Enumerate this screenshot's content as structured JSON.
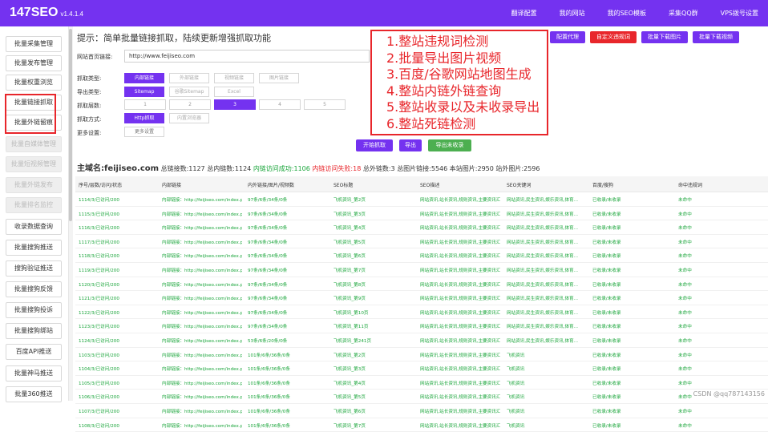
{
  "app": {
    "title": "147SEO",
    "version": "v1.4.1.4"
  },
  "topnav": [
    "翻译配置",
    "我的网站",
    "我的SEO模板",
    "采集QQ群",
    "VPS拨号设置"
  ],
  "sidebar": [
    {
      "label": "批量采集管理",
      "disabled": false
    },
    {
      "label": "批量发布管理",
      "disabled": false
    },
    {
      "label": "批量权重浏览",
      "disabled": false
    },
    {
      "label": "批量链接抓取",
      "disabled": false
    },
    {
      "label": "批量外链留痕",
      "disabled": false
    },
    {
      "label": "批量自媒体管理",
      "disabled": true
    },
    {
      "label": "批量短视频管理",
      "disabled": true
    },
    {
      "label": "批量外链发布",
      "disabled": true
    },
    {
      "label": "批量排名监控",
      "disabled": true
    },
    {
      "label": "收录数据查询",
      "disabled": false
    },
    {
      "label": "批量搜狗推送",
      "disabled": false
    },
    {
      "label": "搜狗验证推送",
      "disabled": false
    },
    {
      "label": "批量搜狗反馈",
      "disabled": false
    },
    {
      "label": "批量搜狗投诉",
      "disabled": false
    },
    {
      "label": "批量搜狗绑站",
      "disabled": false
    },
    {
      "label": "百度API推送",
      "disabled": false
    },
    {
      "label": "批量神马推送",
      "disabled": false
    },
    {
      "label": "批量360推送",
      "disabled": false
    }
  ],
  "hint": "提示：简单批量链接抓取，陆续更新增强抓取功能",
  "actions": [
    {
      "label": "配置代理",
      "style": "purple"
    },
    {
      "label": "自定义违规词",
      "style": "red"
    },
    {
      "label": "批量下载图片",
      "style": "purple"
    },
    {
      "label": "批量下载视频",
      "style": "purple"
    }
  ],
  "form": {
    "url_label": "网站首页链接:",
    "url_value": "http://www.feijiseo.com",
    "type_label": "抓取类型:",
    "type_options": [
      "内部链接",
      "外部链接",
      "视频链接",
      "图片链接"
    ],
    "export_label": "导出类型:",
    "export_options": [
      "Sitemap",
      "谷歌Sitemap",
      "Excel"
    ],
    "count_label": "抓取层数:",
    "count_options": [
      "1",
      "2",
      "3",
      "4",
      "5"
    ],
    "method_label": "抓取方式:",
    "method_options": [
      "Http抓取",
      "内置浏览器"
    ],
    "more_label": "更多设置:",
    "more_button": "更多设置"
  },
  "buttons": {
    "start": "开始抓取",
    "export": "导出",
    "export_unindexed": "导出未收录"
  },
  "features": [
    "1.整站违规词检测",
    "2.批量导出图片视频",
    "3.百度/谷歌网站地图生成",
    "4.整站内链外链查询",
    "5.整站收录以及未收录导出",
    "6.整站死链检测"
  ],
  "stats": {
    "domain_label": "主域名:feijiseo.com",
    "total_links": "总链接数:1127",
    "internal": "总内链数:1124",
    "success": "内链访问成功:1106",
    "fail": "内链访问失败:18",
    "external": "总外链数:3",
    "images": "总图片链接:5546",
    "site_images": "本站图片:2950",
    "offsite_images": "站外图片:2596"
  },
  "table": {
    "columns": [
      "序号/层数/访问/状态",
      "内部链接",
      "内外链接/图片/视频数",
      "SEO标题",
      "SEO描述",
      "SEO关键词",
      "百度/搜狗",
      "命中违规词"
    ],
    "rows": [
      [
        "1114/3/已访问/200",
        "内部链接：http://feijiseo.com/index.php",
        "97条/6条/34条/0条",
        "飞机资讯_第2页",
        "网站资讯,站长资讯,规则资讯,主要资讯汇...",
        "网站资讯,民生资讯,娱乐资讯,体育...",
        "已收录/未收录",
        "未命中"
      ],
      [
        "1115/3/已访问/200",
        "内部链接：http://feijiseo.com/index.php",
        "97条/6条/34条/0条",
        "飞机资讯_第3页",
        "网站资讯,站长资讯,规则资讯,主要资讯汇...",
        "网站资讯,民生资讯,娱乐资讯,体育...",
        "已收录/未收录",
        "未命中"
      ],
      [
        "1116/3/已访问/200",
        "内部链接：http://feijiseo.com/index.php",
        "97条/6条/34条/0条",
        "飞机资讯_第4页",
        "网站资讯,站长资讯,规则资讯,主要资讯汇...",
        "网站资讯,民生资讯,娱乐资讯,体育...",
        "已收录/未收录",
        "未命中"
      ],
      [
        "1117/3/已访问/200",
        "内部链接：http://feijiseo.com/index.php",
        "97条/6条/34条/0条",
        "飞机资讯_第5页",
        "网站资讯,站长资讯,规则资讯,主要资讯汇...",
        "网站资讯,民生资讯,娱乐资讯,体育...",
        "已收录/未收录",
        "未命中"
      ],
      [
        "1118/3/已访问/200",
        "内部链接：http://feijiseo.com/index.php",
        "97条/6条/34条/0条",
        "飞机资讯_第6页",
        "网站资讯,站长资讯,规则资讯,主要资讯汇...",
        "网站资讯,民生资讯,娱乐资讯,体育...",
        "已收录/未收录",
        "未命中"
      ],
      [
        "1119/3/已访问/200",
        "内部链接：http://feijiseo.com/index.php",
        "97条/6条/34条/0条",
        "飞机资讯_第7页",
        "网站资讯,站长资讯,规则资讯,主要资讯汇...",
        "网站资讯,民生资讯,娱乐资讯,体育...",
        "已收录/未收录",
        "未命中"
      ],
      [
        "1120/3/已访问/200",
        "内部链接：http://feijiseo.com/index.php",
        "97条/6条/34条/0条",
        "飞机资讯_第8页",
        "网站资讯,站长资讯,规则资讯,主要资讯汇...",
        "网站资讯,民生资讯,娱乐资讯,体育...",
        "已收录/未收录",
        "未命中"
      ],
      [
        "1121/3/已访问/200",
        "内部链接：http://feijiseo.com/index.php",
        "97条/6条/34条/0条",
        "飞机资讯_第9页",
        "网站资讯,站长资讯,规则资讯,主要资讯汇...",
        "网站资讯,民生资讯,娱乐资讯,体育...",
        "已收录/未收录",
        "未命中"
      ],
      [
        "1122/3/已访问/200",
        "内部链接：http://feijiseo.com/index.php",
        "97条/6条/34条/0条",
        "飞机资讯_第10页",
        "网站资讯,站长资讯,规则资讯,主要资讯汇...",
        "网站资讯,民生资讯,娱乐资讯,体育...",
        "已收录/未收录",
        "未命中"
      ],
      [
        "1123/3/已访问/200",
        "内部链接：http://feijiseo.com/index.php",
        "97条/6条/34条/0条",
        "飞机资讯_第11页",
        "网站资讯,站长资讯,规则资讯,主要资讯汇...",
        "网站资讯,民生资讯,娱乐资讯,体育...",
        "已收录/未收录",
        "未命中"
      ],
      [
        "1124/3/已访问/200",
        "内部链接：http://feijiseo.com/index.php",
        "53条/6条/20条/0条",
        "飞机资讯_第241页",
        "网站资讯,站长资讯,规则资讯,主要资讯汇...",
        "网站资讯,民生资讯,娱乐资讯,体育...",
        "已收录/未收录",
        "未命中"
      ],
      [
        "1103/3/已访问/200",
        "内部链接：http://feijiseo.com/index.php",
        "101条/6条/36条/0条",
        "飞机资讯_第2页",
        "网站资讯,站长资讯,规则资讯,主要资讯汇...",
        "飞机资讯",
        "已收录/未收录",
        "未命中"
      ],
      [
        "1104/3/已访问/200",
        "内部链接：http://feijiseo.com/index.php",
        "101条/6条/36条/0条",
        "飞机资讯_第3页",
        "网站资讯,站长资讯,规则资讯,主要资讯汇...",
        "飞机资讯",
        "已收录/未收录",
        "未命中"
      ],
      [
        "1105/3/已访问/200",
        "内部链接：http://feijiseo.com/index.php",
        "101条/6条/36条/0条",
        "飞机资讯_第4页",
        "网站资讯,站长资讯,规则资讯,主要资讯汇...",
        "飞机资讯",
        "已收录/未收录",
        "未命中"
      ],
      [
        "1106/3/已访问/200",
        "内部链接：http://feijiseo.com/index.php",
        "101条/6条/36条/0条",
        "飞机资讯_第5页",
        "网站资讯,站长资讯,规则资讯,主要资讯汇...",
        "飞机资讯",
        "已收录/未收录",
        "未命中"
      ],
      [
        "1107/3/已访问/200",
        "内部链接：http://feijiseo.com/index.php",
        "101条/6条/36条/0条",
        "飞机资讯_第6页",
        "网站资讯,站长资讯,规则资讯,主要资讯汇...",
        "飞机资讯",
        "已收录/未收录",
        "未命中"
      ],
      [
        "1108/3/已访问/200",
        "内部链接：http://feijiseo.com/index.php",
        "101条/6条/36条/0条",
        "飞机资讯_第7页",
        "网站资讯,站长资讯,规则资讯,主要资讯汇...",
        "飞机资讯",
        "已收录/未收录",
        "未命中"
      ]
    ]
  },
  "watermark": "CSDN @qq787143156",
  "colors": {
    "primary": "#7432f0",
    "danger": "#e8262b",
    "success": "#19a53a"
  }
}
